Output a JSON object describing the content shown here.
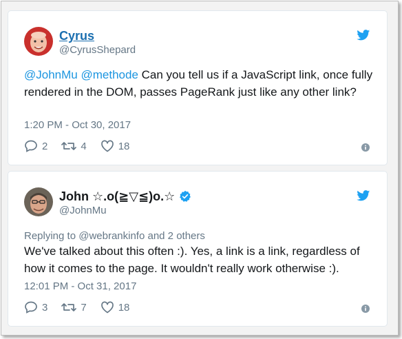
{
  "tweets": [
    {
      "author_name": "Cyrus",
      "author_handle": "@CyrusShepard",
      "verified": false,
      "text_mention_1": "@JohnMu",
      "text_mention_2": "@methode",
      "text_body": " Can you tell us if a JavaScript link, once fully rendered in the DOM, passes PageRank just like any other link?",
      "timestamp": "1:20 PM - Oct 30, 2017",
      "replies": "2",
      "retweets": "4",
      "likes": "18"
    },
    {
      "author_name": "John ☆.o(≧▽≦)o.☆",
      "author_handle": "@JohnMu",
      "verified": true,
      "replying_to": "Replying to @webrankinfo and 2 others",
      "text_body": "We've talked about this often :). Yes, a link is a link, regardless of how it comes to the page. It wouldn't really work otherwise :).",
      "timestamp": "12:01 PM - Oct 31, 2017",
      "replies": "3",
      "retweets": "7",
      "likes": "18"
    }
  ],
  "icons": {
    "brand": "twitter-bird-icon",
    "reply": "reply-icon",
    "retweet": "retweet-icon",
    "like": "heart-icon",
    "info": "info-icon",
    "verified": "verified-badge-icon"
  },
  "colors": {
    "brand_blue": "#1da1f2",
    "link_blue": "#1b95e0",
    "muted": "#657786",
    "text": "#14171a"
  }
}
